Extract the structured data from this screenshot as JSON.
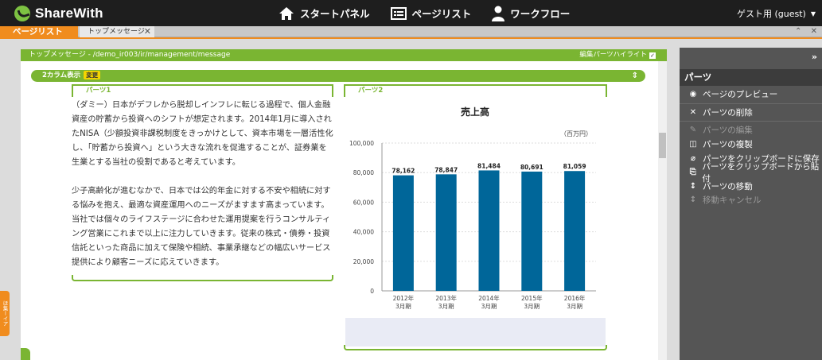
{
  "app": {
    "name": "ShareWith"
  },
  "topnav": [
    {
      "label": "スタートパネル",
      "icon": "home-icon"
    },
    {
      "label": "ページリスト",
      "icon": "page-list-icon"
    },
    {
      "label": "ワークフロー",
      "icon": "user-icon"
    }
  ],
  "user": {
    "label": "ゲスト用 (guest)"
  },
  "tabs": {
    "page_list": "ページリスト",
    "current": "トップメッセージ"
  },
  "side_flag": "ほ集ーイア",
  "editor": {
    "path": "トップメッセージ - /demo_ir003/ir/management/message",
    "highlight_label": "編集パーツハイライト",
    "highlight_checked": "✓",
    "layout_label": "2カラム表示",
    "layout_change": "変更",
    "part1_label": "パーツ1",
    "part2_label": "パーツ2",
    "paragraphs": [
      "（ダミー）日本がデフレから脱却しインフレに転じる過程で、個人金融資産の貯蓄から投資へのシフトが想定されます。2014年1月に導入されたNISA（少額投資非課税制度をきっかけとして、資本市場を一層活性化し、「貯蓄から投資へ」という大きな流れを促進することが、証券業を生業とする当社の役割であると考えています。",
      "少子高齢化が進むなかで、日本では公的年金に対する不安や相続に対する悩みを抱え、最適な資産運用へのニーズがますます高まっています。",
      "当社では個々のライフステージに合わせた運用提案を行うコンサルティング営業にこれまで以上に注力していきます。従来の株式・債券・投資信託といった商品に加えて保険や相続、事業承継などの幅広いサービス提供により顧客ニーズに応えていきます。"
    ]
  },
  "chart_data": {
    "type": "bar",
    "title": "売上高",
    "unit": "（百万円）",
    "categories": [
      "2012年\n3月期",
      "2013年\n3月期",
      "2014年\n3月期",
      "2015年\n3月期",
      "2016年\n3月期"
    ],
    "values": [
      78162,
      78847,
      81484,
      80691,
      81059
    ],
    "value_labels": [
      "78,162",
      "78,847",
      "81,484",
      "80,691",
      "81,059"
    ],
    "yticks": [
      "0",
      "20,000",
      "40,000",
      "60,000",
      "80,000",
      "100,000"
    ],
    "ylim": [
      0,
      100000
    ],
    "bar_color": "#006699",
    "grid": true
  },
  "panel": {
    "title": "パーツ",
    "items": [
      {
        "label": "ページのプレビュー",
        "icon": "eye-icon",
        "glyph": "◉",
        "enabled": true
      },
      {
        "label": "パーツの削除",
        "icon": "close-icon",
        "glyph": "✕",
        "enabled": true
      },
      {
        "label": "パーツの編集",
        "icon": "pencil-icon",
        "glyph": "✎",
        "enabled": false
      },
      {
        "label": "パーツの複製",
        "icon": "book-icon",
        "glyph": "◫",
        "enabled": true
      },
      {
        "label": "パーツをクリップボードに保存",
        "icon": "paperclip-icon",
        "glyph": "⌀",
        "enabled": true
      },
      {
        "label": "パーツをクリップボードから貼付",
        "icon": "paste-icon",
        "glyph": "⎘",
        "enabled": true
      },
      {
        "label": "パーツの移動",
        "icon": "move-icon",
        "glyph": "↕",
        "enabled": true
      },
      {
        "label": "移動キャンセル",
        "icon": "move-cancel-icon",
        "glyph": "↕",
        "enabled": false
      }
    ]
  },
  "colors": {
    "accent_green": "#7ab532",
    "accent_orange": "#f08c1e",
    "topbar": "#1e1e1e"
  }
}
